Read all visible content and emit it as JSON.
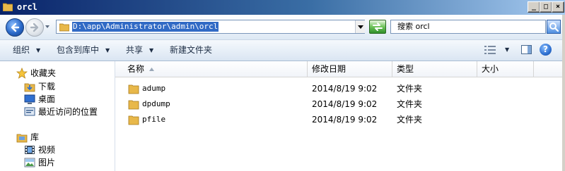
{
  "window": {
    "title": "orcl",
    "controls": {
      "minimize": "_",
      "maximize": "□",
      "close": "×"
    }
  },
  "address": {
    "path": "D:\\app\\Administrator\\admin\\orcl"
  },
  "search": {
    "placeholder": "搜索 orcl"
  },
  "toolbar": {
    "organize": "组织",
    "include_in_library": "包含到库中",
    "share": "共享",
    "new_folder": "新建文件夹",
    "help": "?"
  },
  "sidebar": {
    "favorites": {
      "label": "收藏夹",
      "items": [
        {
          "label": "下载",
          "icon": "download-folder-icon"
        },
        {
          "label": "桌面",
          "icon": "desktop-icon"
        },
        {
          "label": "最近访问的位置",
          "icon": "recent-places-icon"
        }
      ]
    },
    "libraries": {
      "label": "库",
      "items": [
        {
          "label": "视频",
          "icon": "video-library-icon"
        },
        {
          "label": "图片",
          "icon": "picture-library-icon"
        }
      ]
    }
  },
  "list": {
    "columns": [
      "名称",
      "修改日期",
      "类型",
      "大小"
    ],
    "rows": [
      {
        "name": "adump",
        "modified": "2014/8/19 9:02",
        "type": "文件夹",
        "size": ""
      },
      {
        "name": "dpdump",
        "modified": "2014/8/19 9:02",
        "type": "文件夹",
        "size": ""
      },
      {
        "name": "pfile",
        "modified": "2014/8/19 9:02",
        "type": "文件夹",
        "size": ""
      }
    ]
  },
  "colors": {
    "title_bar_start": "#0a246a",
    "selection": "#316ac5",
    "folder": "#e8b84a"
  }
}
